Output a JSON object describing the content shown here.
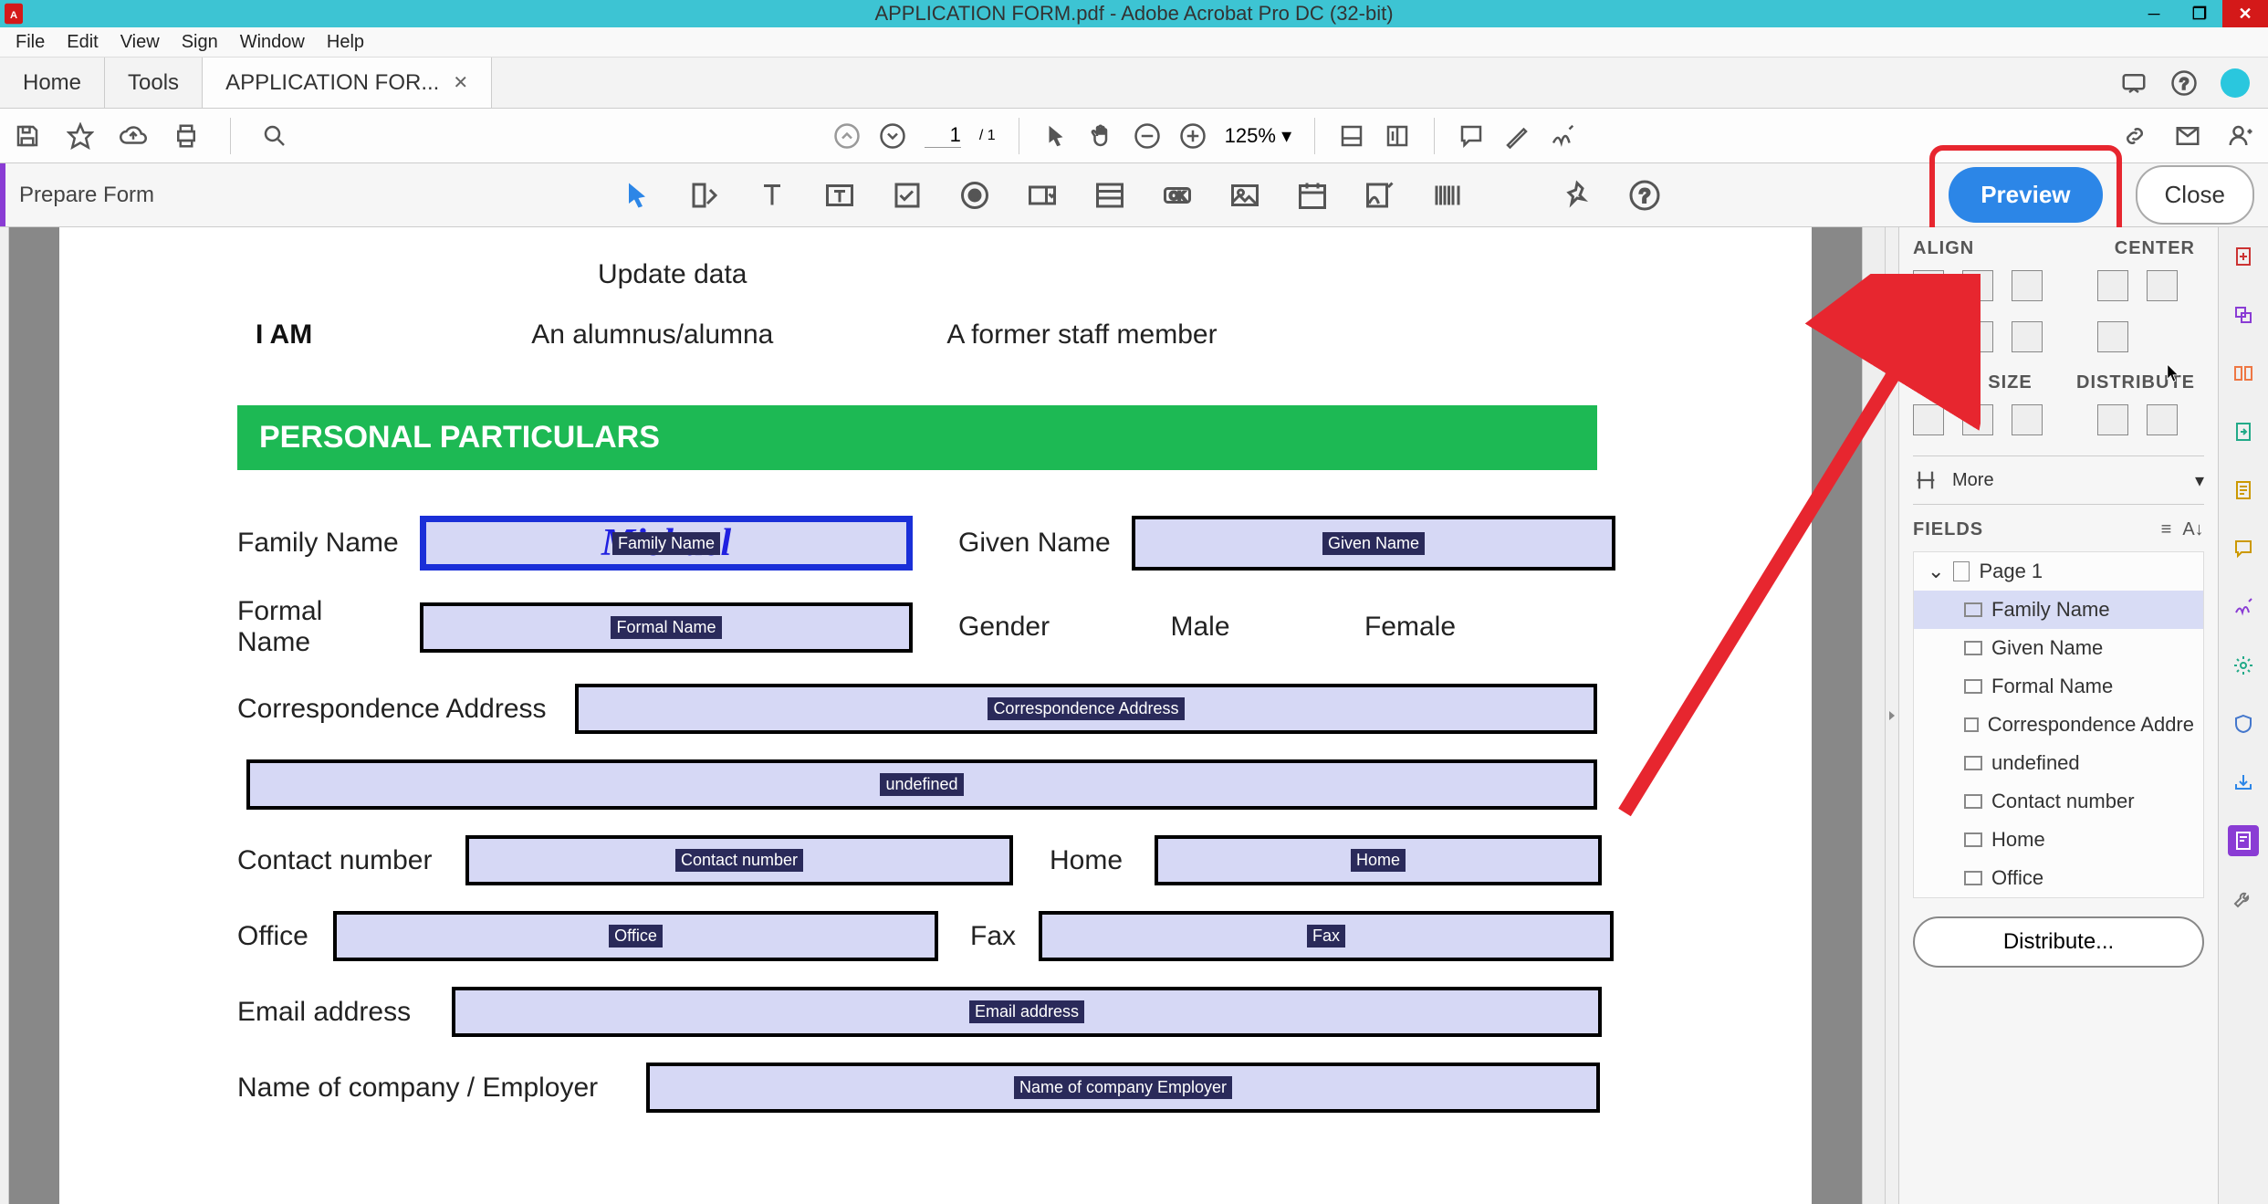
{
  "window": {
    "title": "APPLICATION FORM.pdf - Adobe Acrobat Pro DC (32-bit)"
  },
  "menubar": [
    "File",
    "Edit",
    "View",
    "Sign",
    "Window",
    "Help"
  ],
  "tabs": {
    "home": "Home",
    "tools": "Tools",
    "doc": "APPLICATION FOR..."
  },
  "page": {
    "current": "1",
    "total": "1",
    "zoom": "125%"
  },
  "prepare": {
    "label": "Prepare Form",
    "preview": "Preview",
    "close": "Close"
  },
  "doc": {
    "update": "Update data",
    "iam": "I AM",
    "alum": "An alumnus/alumna",
    "staff": "A former staff member",
    "section": "PERSONAL PARTICULARS",
    "family_label": "Family Name",
    "family_tag": "Family Name",
    "family_bg": "Michael",
    "given_label": "Given Name",
    "given_tag": "Given Name",
    "formal_label": "Formal Name",
    "formal_tag": "Formal Name",
    "gender_label": "Gender",
    "male": "Male",
    "female": "Female",
    "corr_label": "Correspondence Address",
    "corr_tag": "Correspondence Address",
    "undef_tag": "undefined",
    "contact_label": "Contact number",
    "contact_tag": "Contact number",
    "home_label": "Home",
    "home_tag": "Home",
    "office_label": "Office",
    "office_tag": "Office",
    "fax_label": "Fax",
    "fax_tag": "Fax",
    "email_label": "Email address",
    "email_tag": "Email address",
    "company_label": "Name of company / Employer",
    "company_tag": "Name of company  Employer"
  },
  "panel": {
    "align": "ALIGN",
    "center": "CENTER",
    "match": "MATCH SIZE",
    "distribute_h": "DISTRIBUTE",
    "more": "More",
    "fields": "FIELDS",
    "page1": "Page 1",
    "items": [
      "Family Name",
      "Given Name",
      "Formal Name",
      "Correspondence Addre",
      "undefined",
      "Contact number",
      "Home",
      "Office"
    ],
    "distribute_btn": "Distribute..."
  }
}
